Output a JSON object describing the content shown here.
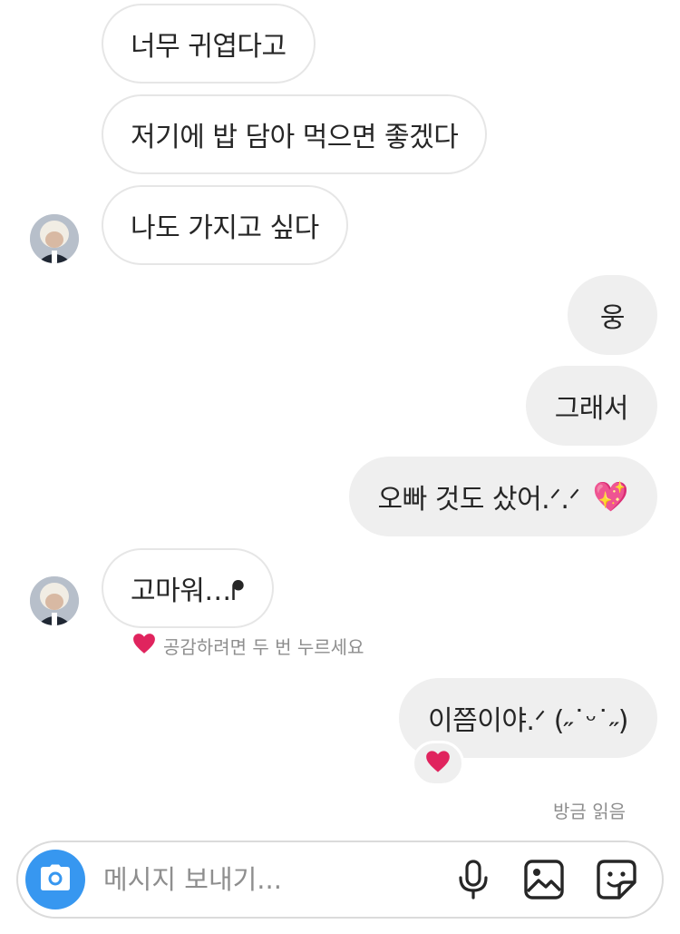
{
  "messages": {
    "m1": "너무 귀엽다고",
    "m2": "저기에 밥 담아 먹으면 좋겠다",
    "m3": "나도 가지고 싶다",
    "m4": "웅",
    "m5": "그래서",
    "m6_text": "오빠 것도 샀어.ᐟ.ᐟ",
    "m6_emoji": "💖",
    "m7": "고마워…ᖰ",
    "m8": "이쯤이야.ᐟ (˶˙ᵕ˙˶)"
  },
  "reaction_hint": "공감하려면 두 번 누르세요",
  "reaction_emoji": "❤️",
  "read_status": "방금 읽음",
  "composer": {
    "placeholder": "메시지 보내기..."
  },
  "icons": [
    "camera-icon",
    "microphone-icon",
    "image-icon",
    "sticker-icon",
    "heart-icon"
  ],
  "colors": {
    "accent": "#3797f0",
    "outgoing_bubble": "#efefef",
    "incoming_border": "#e6e6e6",
    "heart": "#e0245e"
  }
}
